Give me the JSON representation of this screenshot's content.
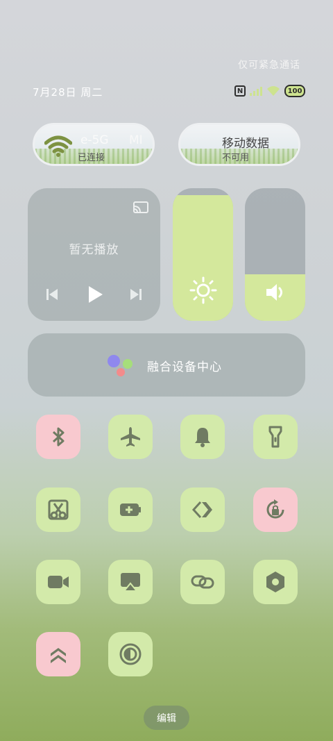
{
  "emergency_text": "仅可紧急通话",
  "status": {
    "date": "7月28日 周二",
    "battery": "100",
    "nfc_label": "N"
  },
  "wifi": {
    "name_left": "e-5G",
    "name_right": "MI",
    "status": "已连接"
  },
  "mobile": {
    "name": "移动数据",
    "status": "不可用"
  },
  "media": {
    "empty_text": "暂无播放"
  },
  "brightness": {
    "level": 0.95
  },
  "volume": {
    "level": 0.35
  },
  "hub": {
    "label": "融合设备中心"
  },
  "tiles": [
    {
      "name": "bluetooth",
      "active": false
    },
    {
      "name": "airplane-mode",
      "active": true
    },
    {
      "name": "ringer",
      "active": true
    },
    {
      "name": "flashlight",
      "active": true
    },
    {
      "name": "screenshot",
      "active": true
    },
    {
      "name": "battery-saver",
      "active": true
    },
    {
      "name": "code-hotspot",
      "active": true
    },
    {
      "name": "rotation-lock",
      "active": false
    },
    {
      "name": "video-record",
      "active": true
    },
    {
      "name": "screen-cast",
      "active": true
    },
    {
      "name": "link",
      "active": true
    },
    {
      "name": "settings-hex",
      "active": true
    },
    {
      "name": "performance",
      "active": false
    },
    {
      "name": "dark-mode",
      "active": true
    }
  ],
  "edit_label": "编辑",
  "colors": {
    "tile_on": "#d3eaaa",
    "tile_off": "#f8c9cf",
    "icon": "#6f7b62",
    "accent": "#d4e89c"
  }
}
